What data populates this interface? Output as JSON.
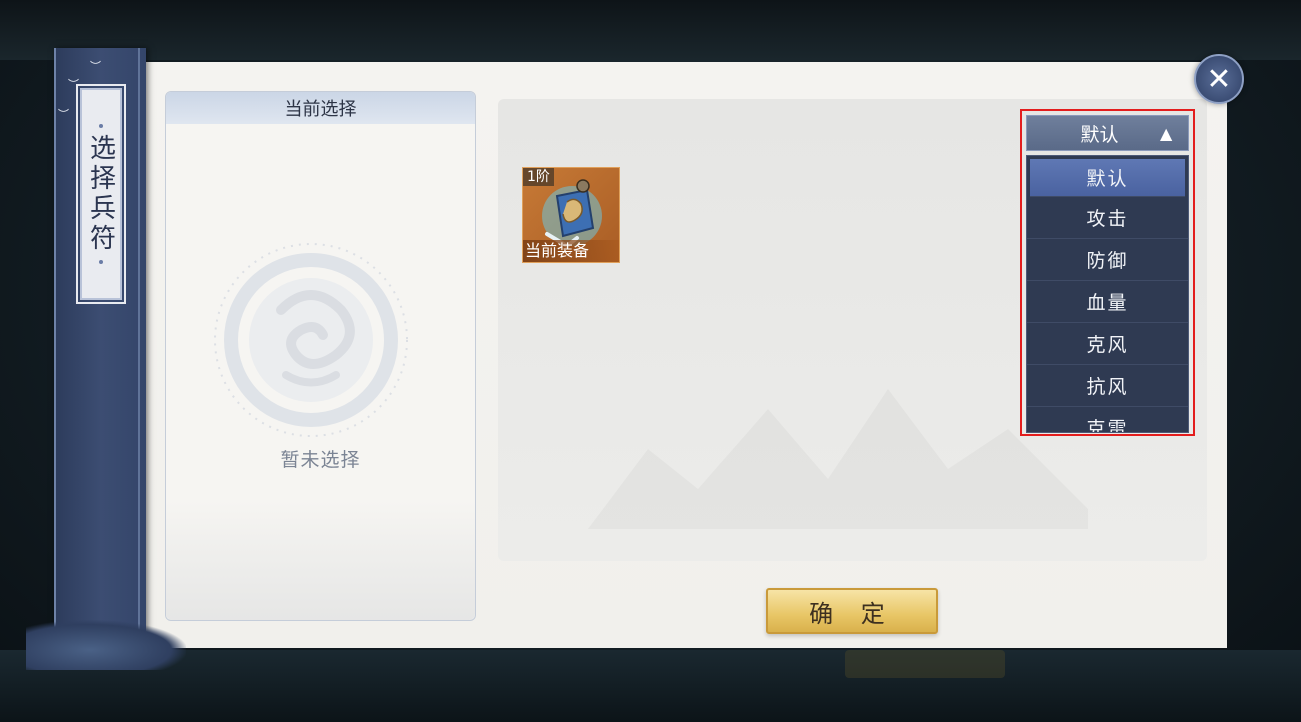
{
  "window": {
    "title": "选择兵符"
  },
  "selection_panel": {
    "header": "当前选择",
    "empty_text": "暂未选择"
  },
  "item": {
    "rank": "1阶",
    "tag": "当前装备"
  },
  "sort_dropdown": {
    "selected": "默认",
    "options": [
      "默认",
      "攻击",
      "防御",
      "血量",
      "克风",
      "抗风",
      "克雷"
    ]
  },
  "confirm_button": "确 定",
  "colors": {
    "accent_red_outline": "#e31d1d",
    "dropdown_bg": "#2f3a52",
    "selected_option": "#5f78b4",
    "confirm_gold": "#e8c666",
    "banner_blue": "#3c4d72"
  }
}
